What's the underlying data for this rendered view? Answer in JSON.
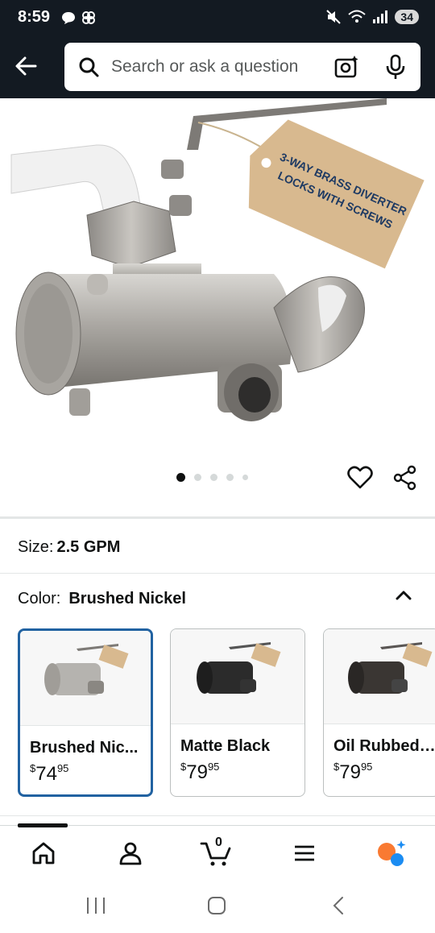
{
  "status_bar": {
    "time": "8:59",
    "battery": "34",
    "left_icons": [
      "chat-bubble-icon",
      "pinwheel-icon"
    ],
    "right_icons": [
      "mute-icon",
      "wifi-icon",
      "signal-icon"
    ]
  },
  "header": {
    "back_icon": "arrow-left-icon",
    "search_placeholder": "Search or ask a question",
    "camera_icon": "camera-search-icon",
    "mic_icon": "microphone-icon"
  },
  "product_image": {
    "tag_line1": "3-WAY BRASS DIVERTER",
    "tag_line2": "LOCKS WITH SCREWS",
    "carousel_count": 5,
    "carousel_active_index": 0
  },
  "size": {
    "label": "Size:",
    "value": "2.5 GPM"
  },
  "color": {
    "label": "Color:",
    "value": "Brushed Nickel",
    "options": [
      {
        "name": "Brushed Nic...",
        "price_symbol": "$",
        "price_whole": "74",
        "price_fraction": "95",
        "finish": "#b5b3af",
        "selected": true
      },
      {
        "name": "Matte Black",
        "price_symbol": "$",
        "price_whole": "79",
        "price_fraction": "95",
        "finish": "#2b2b2b",
        "selected": false
      },
      {
        "name": "Oil Rubbed ...",
        "price_symbol": "$",
        "price_whole": "79",
        "price_fraction": "95",
        "finish": "#3a3633",
        "selected": false
      }
    ]
  },
  "bottom_nav": {
    "items": [
      "home-icon",
      "account-icon",
      "cart-icon",
      "menu-icon",
      "rufus-icon"
    ],
    "cart_count": "0"
  },
  "colors": {
    "header_bg": "#131a22",
    "selected_border": "#2162a1",
    "rufus_orange": "#f97a32",
    "rufus_blue": "#1b8cf2"
  }
}
